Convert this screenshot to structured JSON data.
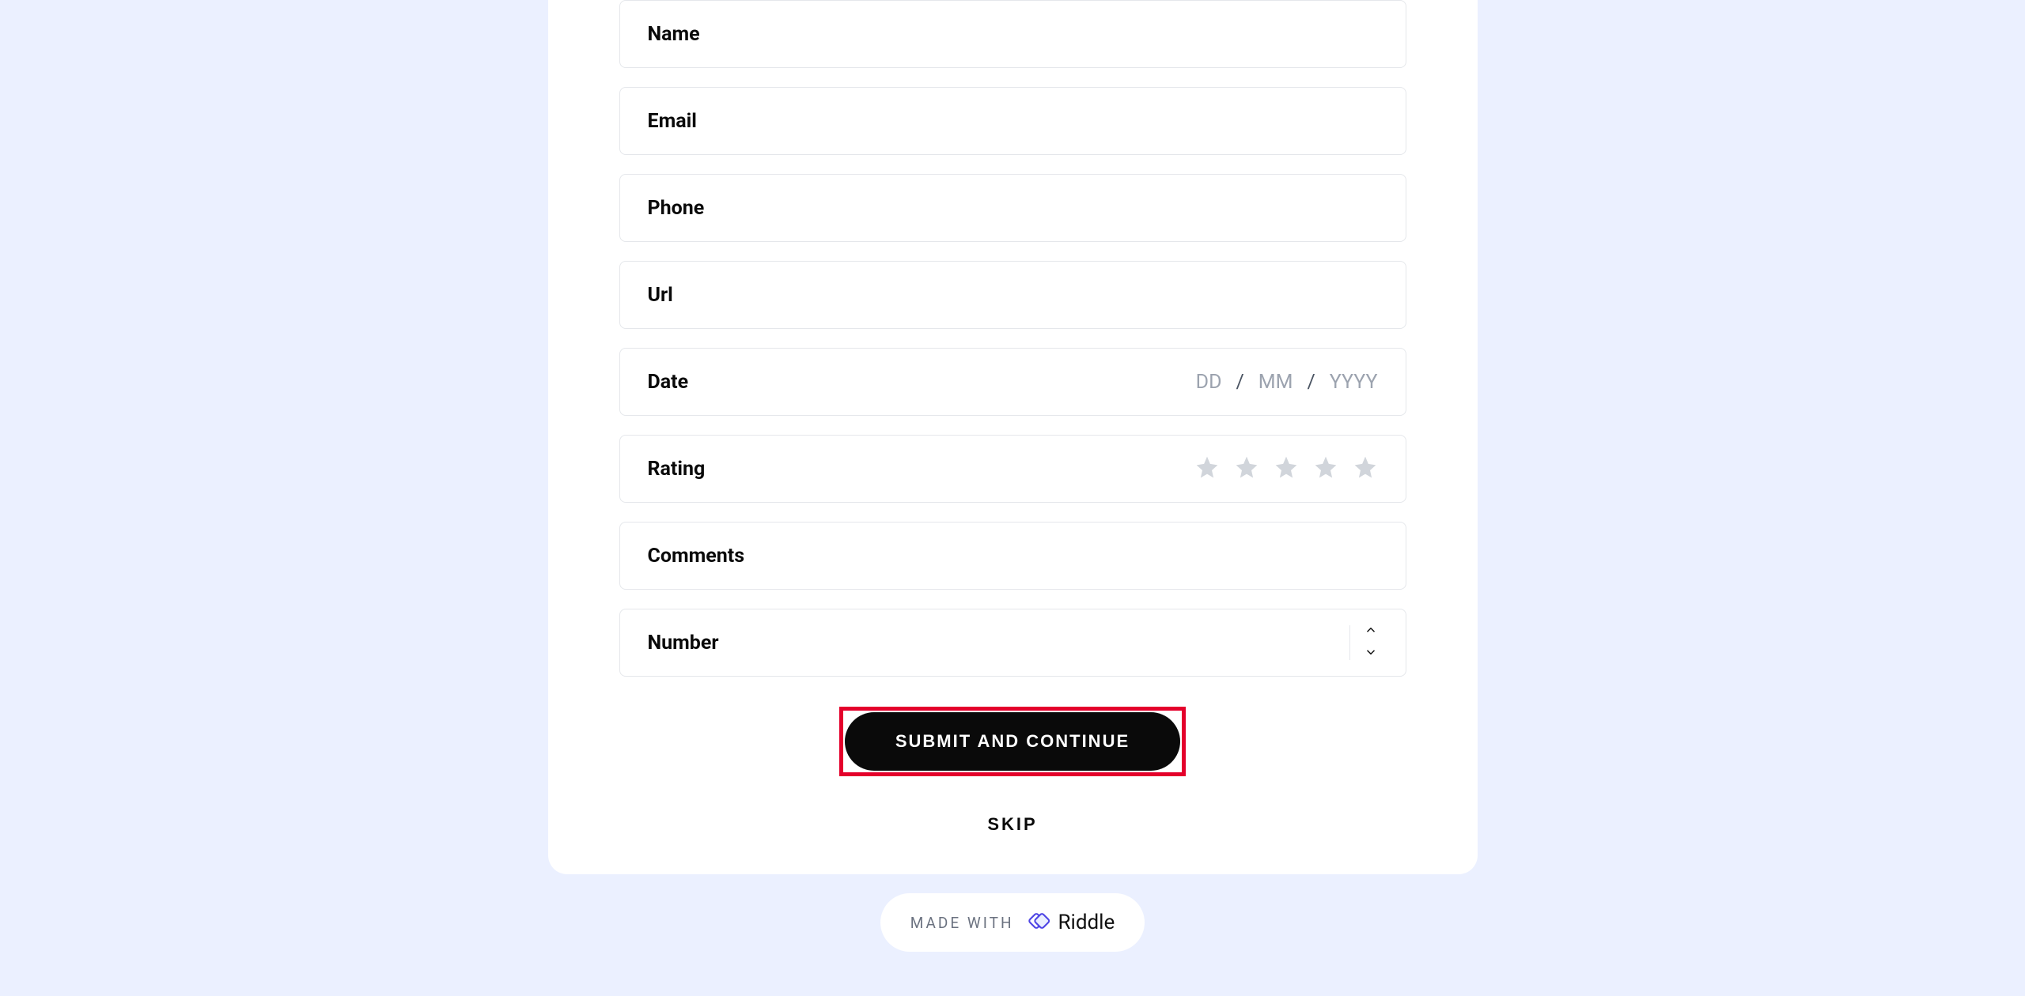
{
  "form": {
    "fields": {
      "name": {
        "label": "Name"
      },
      "email": {
        "label": "Email"
      },
      "phone": {
        "label": "Phone"
      },
      "url": {
        "label": "Url"
      },
      "date": {
        "label": "Date",
        "dd": "DD",
        "mm": "MM",
        "yyyy": "YYYY",
        "sep": "/"
      },
      "rating": {
        "label": "Rating"
      },
      "comments": {
        "label": "Comments"
      },
      "number": {
        "label": "Number"
      }
    },
    "submit_label": "SUBMIT AND CONTINUE",
    "skip_label": "SKIP"
  },
  "footer": {
    "made_with": "MADE WITH",
    "brand": "Riddle"
  }
}
